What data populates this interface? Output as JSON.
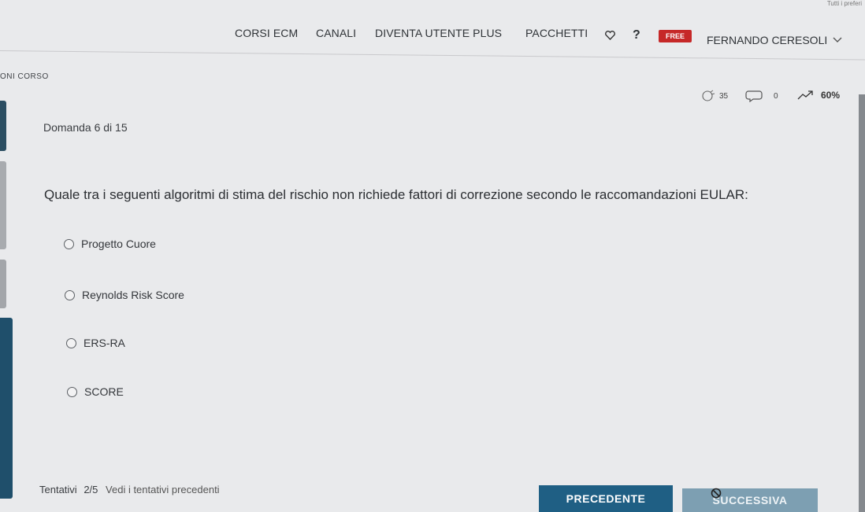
{
  "header": {
    "corner_text": "Tutti i preferi",
    "nav": [
      "CORSI ECM",
      "CANALI",
      "DIVENTA UTENTE PLUS",
      "PACCHETTI"
    ],
    "help_label": "?",
    "free_badge": "FREE",
    "user_name": "FERNANDO CERESOLI"
  },
  "section_label": "ONI CORSO",
  "stats": {
    "likes": "35",
    "comments": "0",
    "progress_label": "60%",
    "progress": 0.6
  },
  "question": {
    "counter": "Domanda 6 di 15",
    "text": "Quale tra i seguenti algoritmi di stima del rischio non richiede fattori di correzione secondo le raccomandazioni EULAR:",
    "options": [
      "Progetto Cuore",
      "Reynolds Risk Score",
      "ERS-RA",
      "SCORE"
    ]
  },
  "footer": {
    "attempts_label": "Tentativi",
    "attempts_value": "2/5",
    "history_link": "Vedi i tentativi precedenti",
    "prev_button": "PRECEDENTE",
    "next_button": "SUCCESSIVA"
  },
  "colors": {
    "primary": "#1f5f84",
    "disabled": "#7d9fb2",
    "badge": "#c62828"
  }
}
